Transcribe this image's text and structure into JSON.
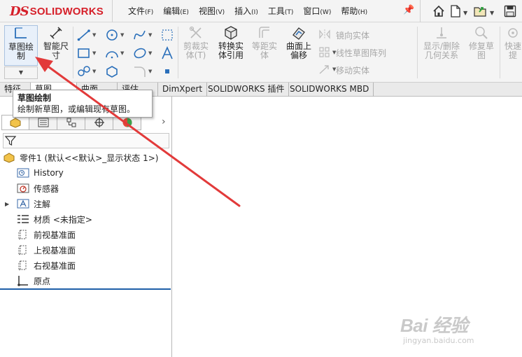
{
  "app": {
    "logo_ds": "DS",
    "logo_name": "SOLIDWORKS"
  },
  "menu": [
    {
      "label": "文件",
      "key": "(F)"
    },
    {
      "label": "编辑",
      "key": "(E)"
    },
    {
      "label": "视图",
      "key": "(V)"
    },
    {
      "label": "插入",
      "key": "(I)"
    },
    {
      "label": "工具",
      "key": "(T)"
    },
    {
      "label": "窗口",
      "key": "(W)"
    },
    {
      "label": "帮助",
      "key": "(H)"
    }
  ],
  "ribbon": {
    "sketch": "草图绘\n制",
    "smart_dim": "智能尺\n寸",
    "trim": "剪裁实\n体(T)",
    "convert": "转换实\n体引用",
    "offset": "等距实\n体",
    "surface_offset": "曲面上\n偏移",
    "mirror": "镜向实体",
    "linear_pattern": "线性草图阵列",
    "move": "移动实体",
    "relations": "显示/删除\n几何关系",
    "repair": "修复草\n图",
    "quick": "快速\n提"
  },
  "tabs": [
    "特征",
    "草图",
    "曲面",
    "评估",
    "DimXpert",
    "SOLIDWORKS 插件",
    "SOLIDWORKS MBD"
  ],
  "tooltip": {
    "title": "草图绘制",
    "description": "绘制新草图，或编辑现有草图。"
  },
  "tree": {
    "root": "零件1 (默认<<默认>_显示状态 1>)",
    "items": [
      "History",
      "传感器",
      "注解",
      "材质 <未指定>",
      "前视基准面",
      "上视基准面",
      "右视基准面",
      "原点"
    ]
  },
  "watermark": {
    "main": "Bai 经验",
    "sub": "jingyan.baidu.com"
  },
  "colors": {
    "brand": "#d6202a",
    "annotation_arrow": "#e23a3a",
    "accent": "#1f5fa8"
  }
}
